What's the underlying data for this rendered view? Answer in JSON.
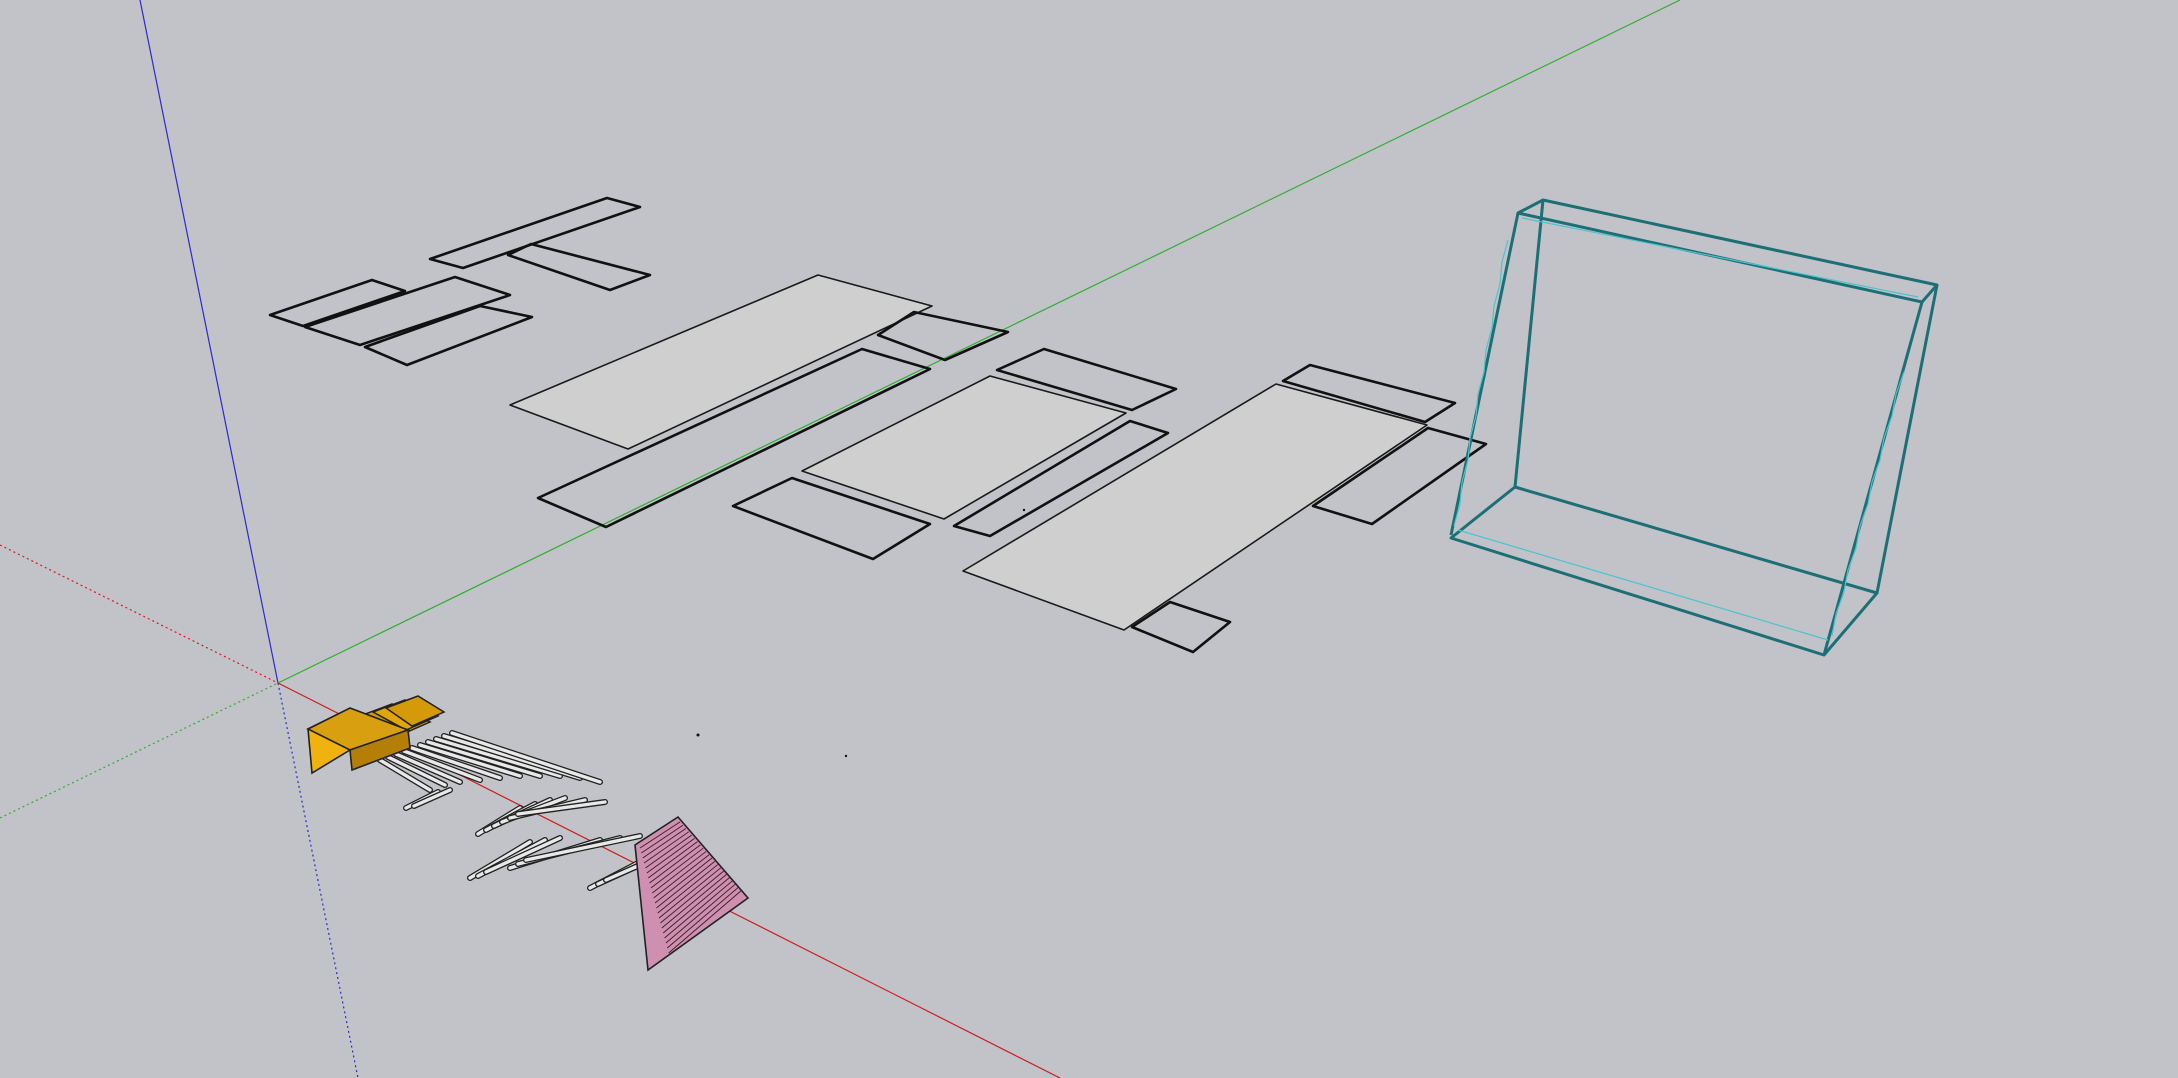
{
  "scene": {
    "background": "#c2c3c8",
    "axes": {
      "red": "#cc1f1f",
      "green": "#2fae2f",
      "blue": "#2a2ad0"
    },
    "colors": {
      "edge": "#111111",
      "face_fill": "#cfcfd0",
      "frame_edge": "#1d6f76",
      "frame_highlight": "#49c4cf",
      "block_fill": "#e1a50d",
      "wedge_fill": "#cf8fb0",
      "green_edge": "#2f7a2f",
      "rod_fill": "#e8e8e8"
    },
    "objects": [
      "axis-origin",
      "flat-panels",
      "cyan-wireframe-frame",
      "yellow-block",
      "rod-bundle",
      "pink-wedge"
    ]
  }
}
